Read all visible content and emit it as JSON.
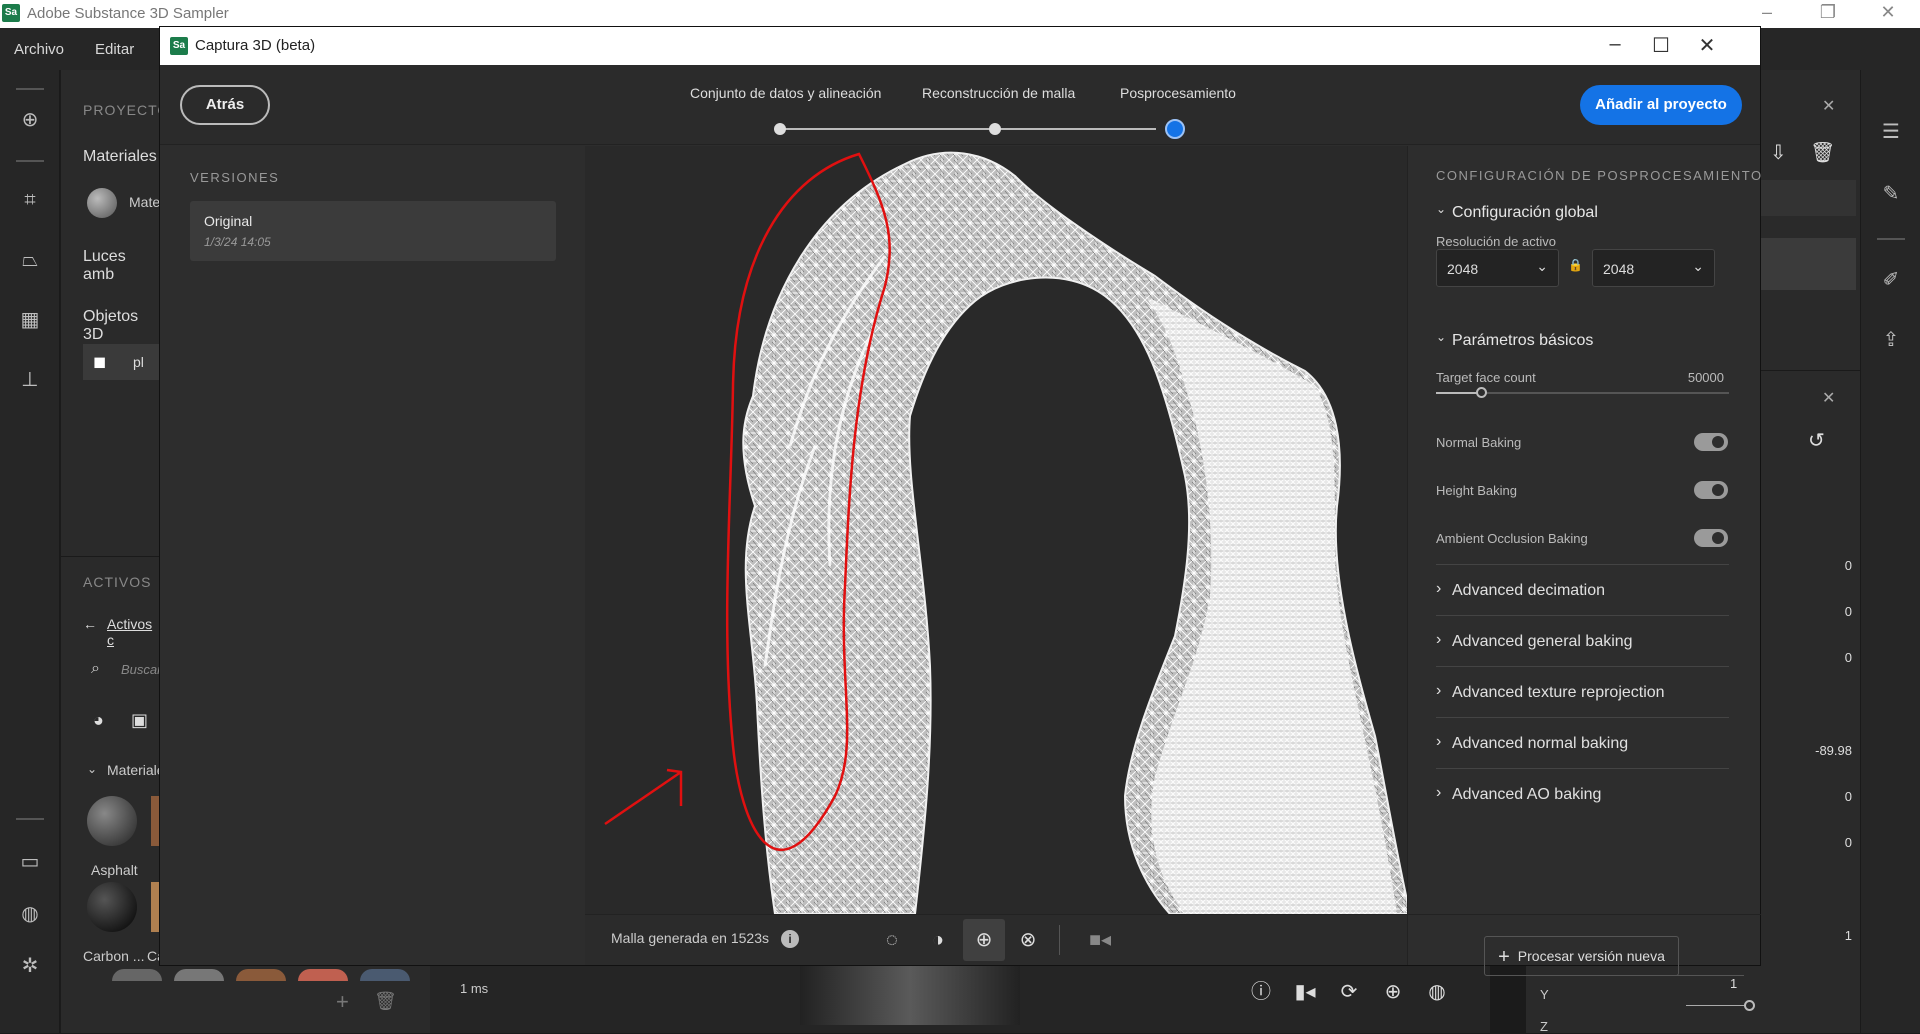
{
  "os_window": {
    "title": "Adobe Substance 3D Sampler",
    "logo": "Sa"
  },
  "menu": {
    "items": [
      "Archivo",
      "Editar"
    ]
  },
  "left_panel": {
    "project_label": "PROYECTO",
    "materials_label": "Materiales",
    "material_item": "Mate",
    "ambient_label": "Luces amb",
    "objects_label": "Objetos 3D",
    "object_item": "pl",
    "assets_label": "ACTIVOS",
    "assets_link": "Activos c",
    "search_placeholder": "Buscar",
    "materials_group": "Materiale",
    "asset_names": [
      "Asphalt",
      "Carbon ...",
      "Ca"
    ]
  },
  "dialog": {
    "logo": "Sa",
    "title": "Captura 3D (beta)",
    "back_label": "Atrás",
    "steps": [
      "Conjunto de datos y alineación",
      "Reconstrucción de malla",
      "Posprocesamiento"
    ],
    "active_step": 2,
    "add_label": "Añadir al proyecto",
    "versions": {
      "heading": "VERSIONES",
      "items": [
        {
          "name": "Original",
          "date": "1/3/24 14:05"
        }
      ]
    },
    "viewport": {
      "status": "Malla generada en 1523s",
      "view_icons": [
        "circle-outline-icon",
        "half-sphere-icon",
        "wireframe-sphere-icon",
        "checker-sphere-icon",
        "camera-icon"
      ]
    },
    "settings": {
      "heading": "CONFIGURACIÓN DE POSPROCESAMIENTO",
      "global_title": "Configuración global",
      "resolution_label": "Resolución de activo",
      "resolution_a": "2048",
      "resolution_b": "2048",
      "basic_title": "Parámetros básicos",
      "target_face_label": "Target face count",
      "target_face_value": "50000",
      "target_face_fraction": 0.05,
      "toggles": [
        {
          "label": "Normal Baking",
          "on": true
        },
        {
          "label": "Height Baking",
          "on": true
        },
        {
          "label": "Ambient Occlusion Baking",
          "on": true
        }
      ],
      "advanced": [
        "Advanced decimation",
        "Advanced general baking",
        "Advanced texture reprojection",
        "Advanced normal baking",
        "Advanced AO baking"
      ],
      "process_label": "Procesar versión nueva"
    }
  },
  "right_panel": {
    "values": [
      "0",
      "0",
      "0",
      "-89.98",
      "0",
      "0",
      "1",
      "1"
    ],
    "y_label": "Y",
    "z_label": "Z"
  },
  "bottom_bar": {
    "time": "1 ms"
  }
}
